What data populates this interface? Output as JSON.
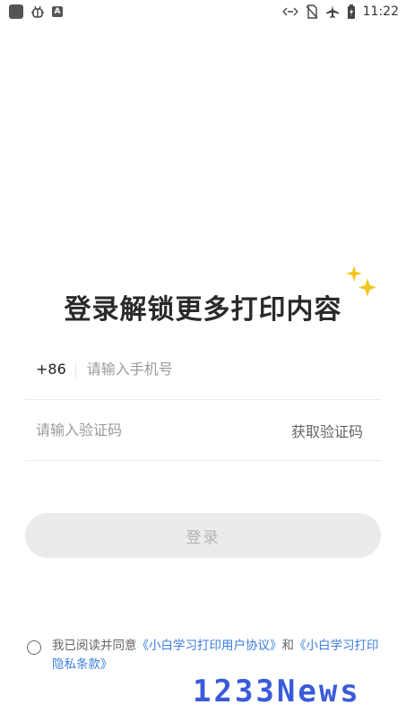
{
  "status_bar": {
    "left_icons": [
      "app-square-icon",
      "bug-icon",
      "font-a-icon"
    ],
    "right_icons": [
      "data-transfer-icon",
      "no-sim-icon",
      "airplane-icon",
      "battery-charging-icon"
    ],
    "time": "11:22"
  },
  "title": "登录解锁更多打印内容",
  "phone": {
    "prefix": "+86",
    "placeholder": "请输入手机号",
    "value": ""
  },
  "code": {
    "placeholder": "请输入验证码",
    "value": "",
    "get_code_label": "获取验证码"
  },
  "login_label": "登录",
  "agreement": {
    "checked": false,
    "prefix": "我已阅读并同意",
    "user_agreement": "《小白学习打印用户协议》",
    "and": "和",
    "privacy_policy": "《小白学习打印隐私条款》"
  },
  "watermark": "1233News",
  "colors": {
    "link": "#3b7ddd",
    "sparkle": "#f5c518",
    "button_bg": "#ebebeb",
    "watermark": "#3a5bd9"
  }
}
